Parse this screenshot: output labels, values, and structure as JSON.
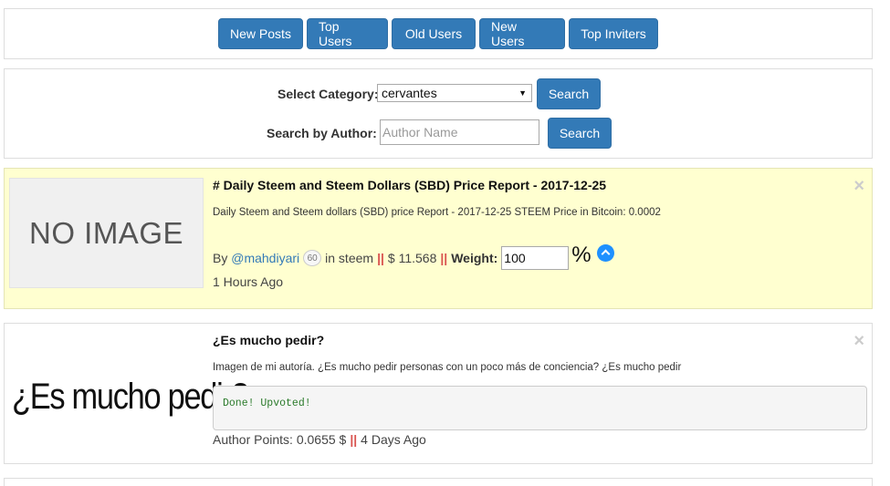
{
  "nav": {
    "buttons": [
      "New Posts",
      "Top Users",
      "Old Users",
      "New Users",
      "Top Inviters"
    ]
  },
  "search": {
    "category_label": "Select Category:",
    "category_value": "cervantes",
    "category_button": "Search",
    "author_label": "Search by Author:",
    "author_placeholder": "Author Name",
    "author_button": "Search"
  },
  "posts": [
    {
      "image_text": "NO IMAGE",
      "title": "# Daily Steem and Steem Dollars (SBD) Price Report - 2017-12-25",
      "summary": "Daily Steem and Steem dollars (SBD) price Report - 2017-12-25 STEEM Price in Bitcoin: 0.0002",
      "by": "By",
      "author": "@mahdiyari",
      "reputation": "60",
      "in_label": "in steem",
      "separator": "||",
      "payout": "$ 11.568",
      "weight_label": "Weight:",
      "weight_value": "100",
      "percent": "%",
      "time_ago": "1 Hours Ago",
      "close": "×",
      "highlight_color": "#ffffd0"
    },
    {
      "image_text": "¿Es mucho pedir?",
      "title": "¿Es mucho pedir?",
      "summary": "Imagen de mi autoría. ¿Es mucho pedir personas con un poco más de conciencia? ¿Es mucho pedir",
      "status": "Done! Upvoted!",
      "points_label": "Author Points: 0.0655 $",
      "separator": "||",
      "time_ago": "4 Days Ago",
      "close": "×"
    }
  ],
  "colors": {
    "button": "#337ab7",
    "link": "#337ab7",
    "separator": "#d9534f",
    "upvote_icon": "#1e90ff"
  }
}
